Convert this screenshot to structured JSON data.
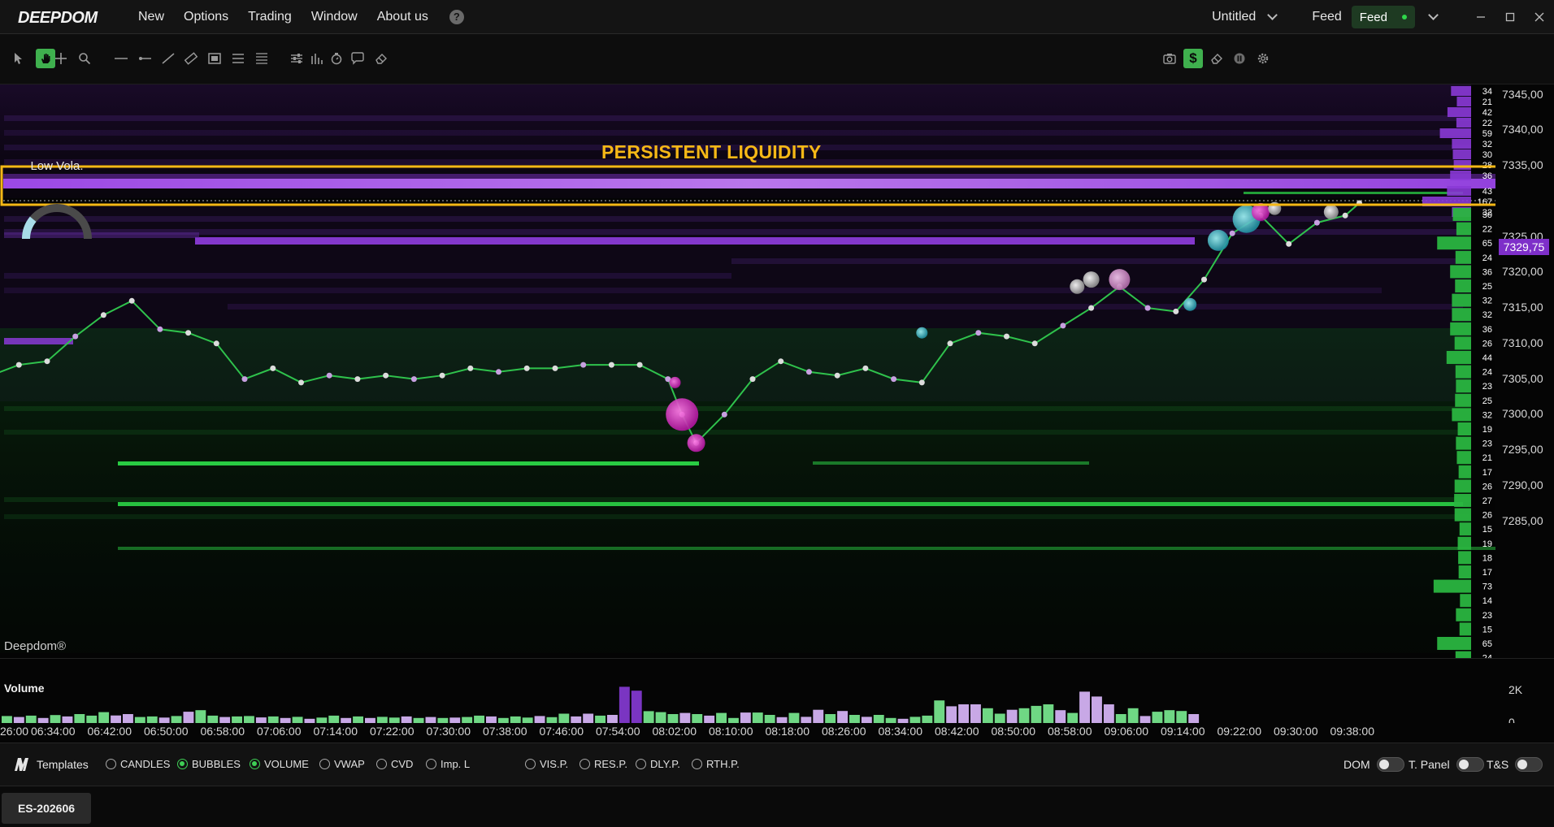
{
  "app": {
    "logo_text": "DEEPDOM",
    "menu": [
      "New",
      "Options",
      "Trading",
      "Window",
      "About us"
    ],
    "workspace": "Untitled",
    "feed_label": "Feed",
    "feed_status": "Feed",
    "window_controls": [
      "minimize",
      "maximize",
      "close"
    ]
  },
  "toolbar": {
    "left_tools": [
      "pointer-icon",
      "hand-icon",
      "crosshair-icon",
      "zoom-icon",
      "horizontal-line-icon",
      "ray-icon",
      "trend-line-icon",
      "ruler-icon",
      "rectangle-icon",
      "lines-icon",
      "fib-icon",
      "settings-sliders-icon",
      "volume-profile-icon",
      "timer-icon",
      "comment-icon",
      "eraser-icon"
    ],
    "right_tools": [
      "camera-icon",
      "dollar-icon",
      "eraser-icon",
      "pause-icon",
      "gear-icon"
    ],
    "active_tools": [
      "hand-icon",
      "dollar-icon"
    ]
  },
  "chart": {
    "instrument": "ES-202606",
    "volatility_label": "Low Vola.",
    "volatility_level": 0.22,
    "annotation": "PERSISTENT LIQUIDITY",
    "watermark": "Deepdom®",
    "current_price": "7329,75",
    "price_ticks": [
      "7345,00",
      "7340,00",
      "7335,00",
      "7325,00",
      "7320,00",
      "7315,00",
      "7310,00",
      "7305,00",
      "7300,00",
      "7295,00",
      "7290,00",
      "7285,00"
    ],
    "dom_ask_sizes": [
      "34",
      "21",
      "42",
      "22",
      "59",
      "32",
      "30",
      "28",
      "36",
      "43",
      "167",
      "32"
    ],
    "dom_bid_sizes": [
      "30",
      "22",
      "65",
      "24",
      "36",
      "25",
      "32",
      "32",
      "36",
      "26",
      "44",
      "24",
      "23",
      "25",
      "32",
      "19",
      "23",
      "21",
      "17",
      "26",
      "27",
      "26",
      "15",
      "19",
      "18",
      "17",
      "73",
      "14",
      "23",
      "15",
      "65",
      "24"
    ],
    "colors": {
      "ask_liquidity": "#8a3ad6",
      "bid_liquidity": "#2ee04a",
      "annotation": "#f5b816",
      "price_line": "#2fc24c"
    }
  },
  "chart_data": {
    "type": "line",
    "x_ticks": [
      "26:00",
      "06:34:00",
      "06:42:00",
      "06:50:00",
      "06:58:00",
      "07:06:00",
      "07:14:00",
      "07:22:00",
      "07:30:00",
      "07:38:00",
      "07:46:00",
      "07:54:00",
      "08:02:00",
      "08:10:00",
      "08:18:00",
      "08:26:00",
      "08:34:00",
      "08:42:00",
      "08:50:00",
      "08:58:00",
      "09:06:00",
      "09:14:00",
      "09:22:00",
      "09:30:00",
      "09:38:00"
    ],
    "x": [
      "06:26:00",
      "06:30:00",
      "06:34:00",
      "06:38:00",
      "06:42:00",
      "06:46:00",
      "06:50:00",
      "06:54:00",
      "06:58:00",
      "07:02:00",
      "07:06:00",
      "07:10:00",
      "07:14:00",
      "07:18:00",
      "07:22:00",
      "07:26:00",
      "07:30:00",
      "07:34:00",
      "07:38:00",
      "07:42:00",
      "07:46:00",
      "07:50:00",
      "07:54:00",
      "07:58:00",
      "08:02:00",
      "08:04:00",
      "08:06:00",
      "08:10:00",
      "08:14:00",
      "08:18:00",
      "08:22:00",
      "08:26:00",
      "08:30:00",
      "08:34:00",
      "08:38:00",
      "08:42:00",
      "08:46:00",
      "08:50:00",
      "08:54:00",
      "08:58:00",
      "09:02:00",
      "09:06:00",
      "09:10:00",
      "09:14:00",
      "09:18:00",
      "09:22:00",
      "09:26:00",
      "09:30:00",
      "09:34:00",
      "09:38:00",
      "09:40:00"
    ],
    "y": [
      7305.5,
      7307.0,
      7307.5,
      7311.0,
      7314.0,
      7316.0,
      7312.0,
      7311.5,
      7310.0,
      7305.0,
      7306.5,
      7304.5,
      7305.5,
      7305.0,
      7305.5,
      7305.0,
      7305.5,
      7306.5,
      7306.0,
      7306.5,
      7306.5,
      7307.0,
      7307.0,
      7307.0,
      7305.0,
      7300.0,
      7296.0,
      7300.0,
      7305.0,
      7307.5,
      7306.0,
      7305.5,
      7306.5,
      7305.0,
      7304.5,
      7310.0,
      7311.5,
      7311.0,
      7310.0,
      7312.5,
      7315.0,
      7318.0,
      7315.0,
      7314.5,
      7319.0,
      7325.5,
      7328.0,
      7324.0,
      7327.0,
      7328.0,
      7329.75
    ],
    "ylim": [
      7282.0,
      7347.0
    ],
    "volume": {
      "label": "Volume",
      "y_ticks": [
        "2K",
        "0"
      ],
      "ylim": [
        0,
        2500
      ],
      "values": [
        400,
        350,
        420,
        300,
        450,
        380,
        500,
        420,
        600,
        430,
        500,
        350,
        380,
        320,
        400,
        620,
        700,
        420,
        350,
        380,
        400,
        330,
        380,
        300,
        360,
        260,
        320,
        420,
        300,
        380,
        300,
        360,
        320,
        380,
        300,
        350,
        300,
        320,
        350,
        420,
        380,
        300,
        380,
        320,
        400,
        340,
        520,
        380,
        520,
        420,
        460,
        1900,
        1700,
        650,
        600,
        500,
        560,
        500,
        420,
        560,
        300,
        580,
        580,
        460,
        340,
        560,
        360,
        720,
        500,
        660,
        460,
        360,
        460,
        300,
        260,
        360,
        420,
        1200,
        900,
        1000,
        1000,
        800,
        520,
        720,
        800,
        920,
        1000,
        700,
        560,
        1650,
        1400,
        1000,
        500,
        800,
        400,
        620,
        700,
        660,
        500
      ],
      "buy_sell": [
        "b",
        "s",
        "b",
        "s",
        "b",
        "s",
        "b",
        "b",
        "b",
        "s",
        "s",
        "b",
        "b",
        "s",
        "b",
        "s",
        "b",
        "b",
        "s",
        "b",
        "b",
        "s",
        "b",
        "s",
        "b",
        "s",
        "b",
        "b",
        "s",
        "b",
        "s",
        "b",
        "b",
        "s",
        "b",
        "s",
        "b",
        "s",
        "b",
        "b",
        "s",
        "b",
        "b",
        "b",
        "s",
        "b",
        "b",
        "s",
        "s",
        "b",
        "s",
        "s",
        "s",
        "b",
        "b",
        "b",
        "s",
        "b",
        "s",
        "b",
        "b",
        "s",
        "b",
        "b",
        "s",
        "b",
        "s",
        "s",
        "b",
        "s",
        "b",
        "s",
        "b",
        "b",
        "s",
        "b",
        "b",
        "b",
        "s",
        "s",
        "s",
        "b",
        "b",
        "s",
        "b",
        "b",
        "b",
        "s",
        "b",
        "s",
        "s",
        "s",
        "b",
        "b",
        "s",
        "b",
        "b",
        "b",
        "s"
      ]
    }
  },
  "templates": {
    "label": "Templates",
    "options": [
      {
        "label": "CANDLES",
        "on": false
      },
      {
        "label": "BUBBLES",
        "on": true
      },
      {
        "label": "VOLUME",
        "on": true
      },
      {
        "label": "VWAP",
        "on": false
      },
      {
        "label": "CVD",
        "on": false
      },
      {
        "label": "Imp. L",
        "on": false
      }
    ],
    "profiles": [
      {
        "label": "VIS.P.",
        "on": false
      },
      {
        "label": "RES.P.",
        "on": false
      },
      {
        "label": "DLY.P.",
        "on": false
      },
      {
        "label": "RTH.P.",
        "on": false
      }
    ],
    "toggles": [
      "DOM",
      "T. Panel",
      "T&S"
    ]
  }
}
